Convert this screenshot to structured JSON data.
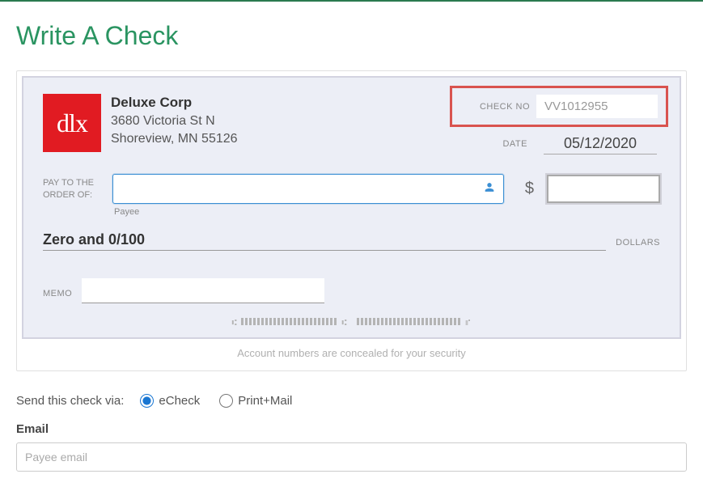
{
  "page": {
    "title": "Write A Check"
  },
  "check": {
    "payer": {
      "logo_text": "dlx",
      "name": "Deluxe Corp",
      "address1": "3680 Victoria St N",
      "address2": "Shoreview, MN 55126"
    },
    "check_no_label": "CHECK NO",
    "check_no": "VV1012955",
    "date_label": "DATE",
    "date": "05/12/2020",
    "pay_to_label_1": "PAY TO THE",
    "pay_to_label_2": "ORDER OF:",
    "payee_value": "",
    "payee_sublabel": "Payee",
    "dollar_symbol": "$",
    "amount_value": "",
    "amount_words": "Zero and 0/100",
    "dollars_label": "DOLLARS",
    "memo_label": "MEMO",
    "memo_value": "",
    "concealed_note": "Account numbers are concealed for your security"
  },
  "send": {
    "label": "Send this check via:",
    "option_echeck": "eCheck",
    "option_printmail": "Print+Mail",
    "selected": "echeck"
  },
  "email": {
    "label": "Email",
    "placeholder": "Payee email",
    "value": ""
  }
}
